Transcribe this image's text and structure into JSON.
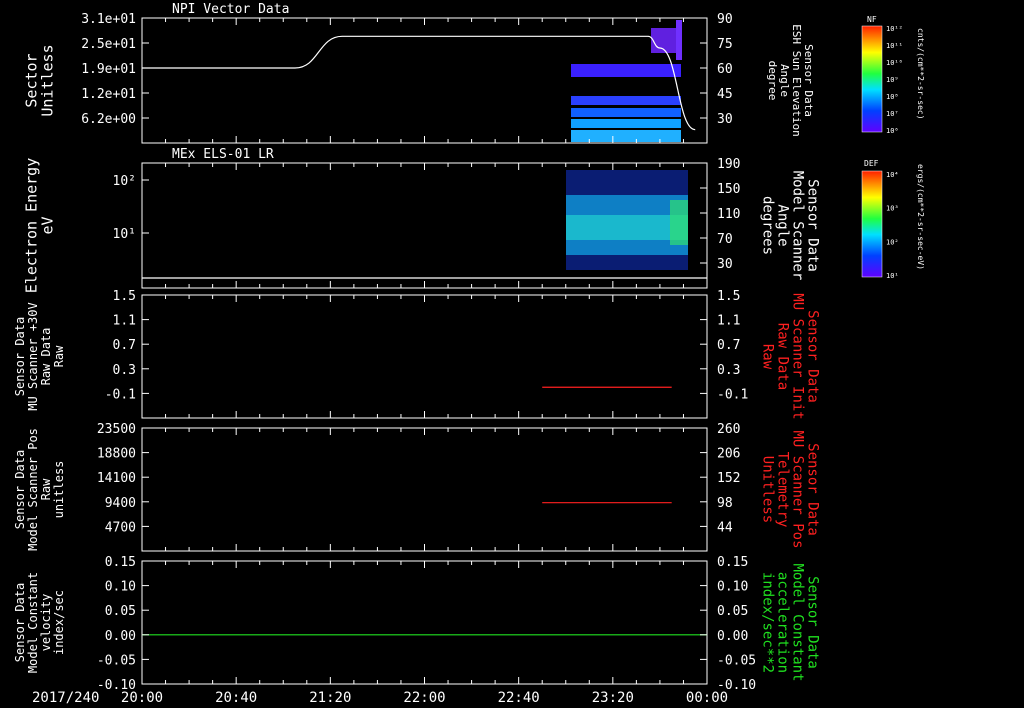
{
  "date_label": "2017/240",
  "time_ticks": [
    "20:00",
    "20:40",
    "21:20",
    "22:00",
    "22:40",
    "23:20",
    "00:00"
  ],
  "colors": {
    "axis": "#ffffff",
    "red": "#ff2020",
    "green": "#20e020"
  },
  "panels": [
    {
      "id": "p1",
      "title": "NPI Vector Data",
      "left_label": [
        "Sector",
        "Unitless"
      ],
      "left_ticks": [
        "3.1e+01",
        "2.5e+01",
        "1.9e+01",
        "1.2e+01",
        "6.2e+00"
      ],
      "right_label": [
        "Sensor Data",
        "ESH Sun Elevation",
        "Angle",
        "degree"
      ],
      "right_ticks": [
        "90",
        "75",
        "60",
        "45",
        "30"
      ],
      "right_color": "white"
    },
    {
      "id": "p2",
      "title": "MEx ELS-01 LR",
      "left_label": [
        "Electron Energy",
        "eV"
      ],
      "left_ticks": [
        "10²",
        "10¹"
      ],
      "right_label": [
        "Sensor Data",
        "Model Scanner",
        "Angle",
        "degrees"
      ],
      "right_ticks": [
        "190",
        "150",
        "110",
        "70",
        "30"
      ],
      "right_color": "white"
    },
    {
      "id": "p3",
      "left_label": [
        "Sensor Data",
        "MU Scanner +30V",
        "Raw Data",
        "Raw"
      ],
      "left_ticks": [
        "1.5",
        "1.1",
        "0.7",
        "0.3",
        "-0.1"
      ],
      "right_label": [
        "Sensor Data",
        "MU Scanner Init",
        "Raw Data",
        "Raw"
      ],
      "right_ticks": [
        "1.5",
        "1.1",
        "0.7",
        "0.3",
        "-0.1"
      ],
      "right_color": "red"
    },
    {
      "id": "p4",
      "left_label": [
        "Sensor Data",
        "Model Scanner Pos",
        "Raw",
        "unitless"
      ],
      "left_ticks": [
        "23500",
        "18800",
        "14100",
        "9400",
        "4700"
      ],
      "right_label": [
        "Sensor Data",
        "MU Scanner Pos",
        "Telemetry",
        "Unitless"
      ],
      "right_ticks": [
        "260",
        "206",
        "152",
        "98",
        "44"
      ],
      "right_color": "red"
    },
    {
      "id": "p5",
      "left_label": [
        "Sensor Data",
        "Model Constant",
        "velocity",
        "index/sec"
      ],
      "left_ticks": [
        "0.15",
        "0.10",
        "0.05",
        "0.00",
        "-0.05",
        "-0.10"
      ],
      "right_label": [
        "Sensor Data",
        "Model Constant",
        "acceleration",
        "index/sec**2"
      ],
      "right_ticks": [
        "0.15",
        "0.10",
        "0.05",
        "0.00",
        "-0.05",
        "-0.10"
      ],
      "right_color": "green"
    }
  ],
  "colorbars": [
    {
      "title": "NF",
      "unit": "cnts/(cm**2-sr-sec)",
      "ticks": [
        "10¹²",
        "10¹¹",
        "10¹⁰",
        "10⁹",
        "10⁸",
        "10⁷",
        "10⁶"
      ]
    },
    {
      "title": "DEF",
      "unit": "ergs/(cm**2-sr-sec-eV)",
      "ticks": [
        "10⁴",
        "10³",
        "10²",
        "10¹"
      ]
    }
  ],
  "chart_data": [
    {
      "panel": "p1",
      "type": "line",
      "series": [
        {
          "axis": "right",
          "x": [
            "20:00",
            "20:30",
            "21:05",
            "21:25",
            "23:35",
            "23:40",
            "23:55"
          ],
          "y": [
            60,
            60,
            60,
            79,
            79,
            72,
            23
          ]
        }
      ],
      "spectrogram": {
        "axis": "left",
        "time_range": [
          "23:00",
          "23:40"
        ],
        "present": true
      }
    },
    {
      "panel": "p2",
      "type": "line",
      "series": [
        {
          "axis": "right",
          "x": [
            "20:00",
            "00:00"
          ],
          "y": [
            6,
            6
          ]
        }
      ],
      "spectrogram": {
        "axis": "left",
        "time_range": [
          "23:00",
          "23:45"
        ],
        "present": true
      }
    },
    {
      "panel": "p3",
      "type": "line",
      "series": [
        {
          "axis": "right",
          "x": [
            "22:50",
            "23:45"
          ],
          "y": [
            0.0,
            0.0
          ],
          "color": "red"
        }
      ]
    },
    {
      "panel": "p4",
      "type": "line",
      "series": [
        {
          "axis": "right",
          "x": [
            "22:50",
            "23:45"
          ],
          "y": [
            96,
            96
          ],
          "color": "red"
        }
      ]
    },
    {
      "panel": "p5",
      "type": "line",
      "series": [
        {
          "axis": "right",
          "x": [
            "20:00",
            "00:00"
          ],
          "y": [
            0.0,
            0.0
          ],
          "color": "green"
        }
      ]
    }
  ]
}
